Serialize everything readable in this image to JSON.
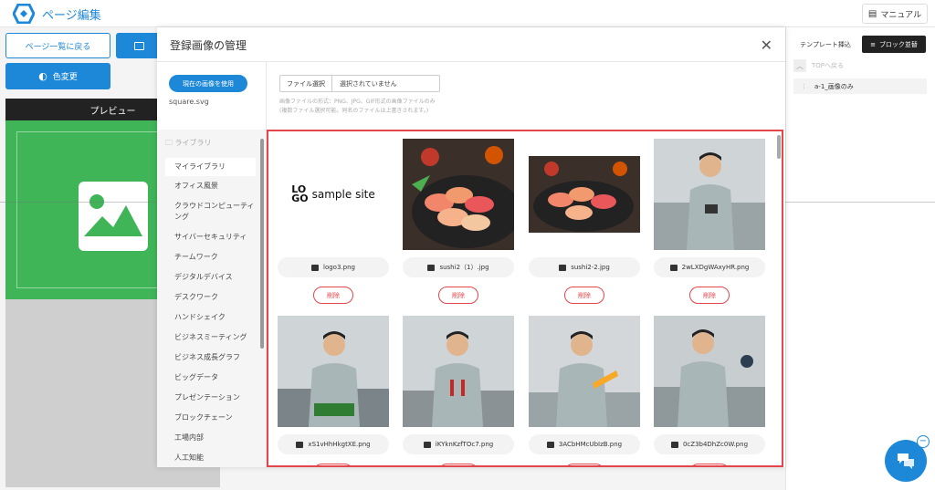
{
  "header": {
    "title": "ページ編集",
    "manual_label": "マニュアル"
  },
  "left": {
    "back_label": "ページ一覧に戻る",
    "color_label": "色変更",
    "preview_label": "プレビュー"
  },
  "right": {
    "tab_template": "テンプレート挿込",
    "tab_block": "ブロック並替",
    "top_link": "TOPへ戻る",
    "block_item": "a-1_画像のみ"
  },
  "modal": {
    "title": "登録画像の管理",
    "use_current_label": "現在の画像を使用",
    "current_file": "square.svg",
    "file_select_label": "ファイル選択",
    "file_status": "選択されていません",
    "note_1": "画像ファイルの形式：PNG、JPG、GIF形式の画像ファイルのみ",
    "note_2": "(複数ファイル選択可能。同名のファイルは上書きされます。)",
    "library_heading": "ライブラリ",
    "library_items": [
      "マイライブラリ",
      "オフィス風景",
      "クラウドコンピューティング",
      "サイバーセキュリティ",
      "チームワーク",
      "デジタルデバイス",
      "デスクワーク",
      "ハンドシェイク",
      "ビジネスミーティング",
      "ビジネス成長グラフ",
      "ビッグデータ",
      "プレゼンテーション",
      "ブロックチェーン",
      "工場内部",
      "人工知能"
    ],
    "logo_text_1": "LO",
    "logo_text_2": "GO",
    "logo_site": "sample site",
    "delete_label": "削除",
    "files": [
      "logo3.png",
      "sushi2（1）.jpg",
      "sushi2-2.jpg",
      "2wLXDgWAxyHR.png",
      "xS1vHhHkgtXE.png",
      "iKYknKzfTOc7.png",
      "3ACbHMcUbIzB.png",
      "0cZ3b4DhZc0W.png"
    ]
  },
  "colors": {
    "accent": "#1e88d8",
    "danger": "#e3464b",
    "preview_green": "#3fb558"
  }
}
